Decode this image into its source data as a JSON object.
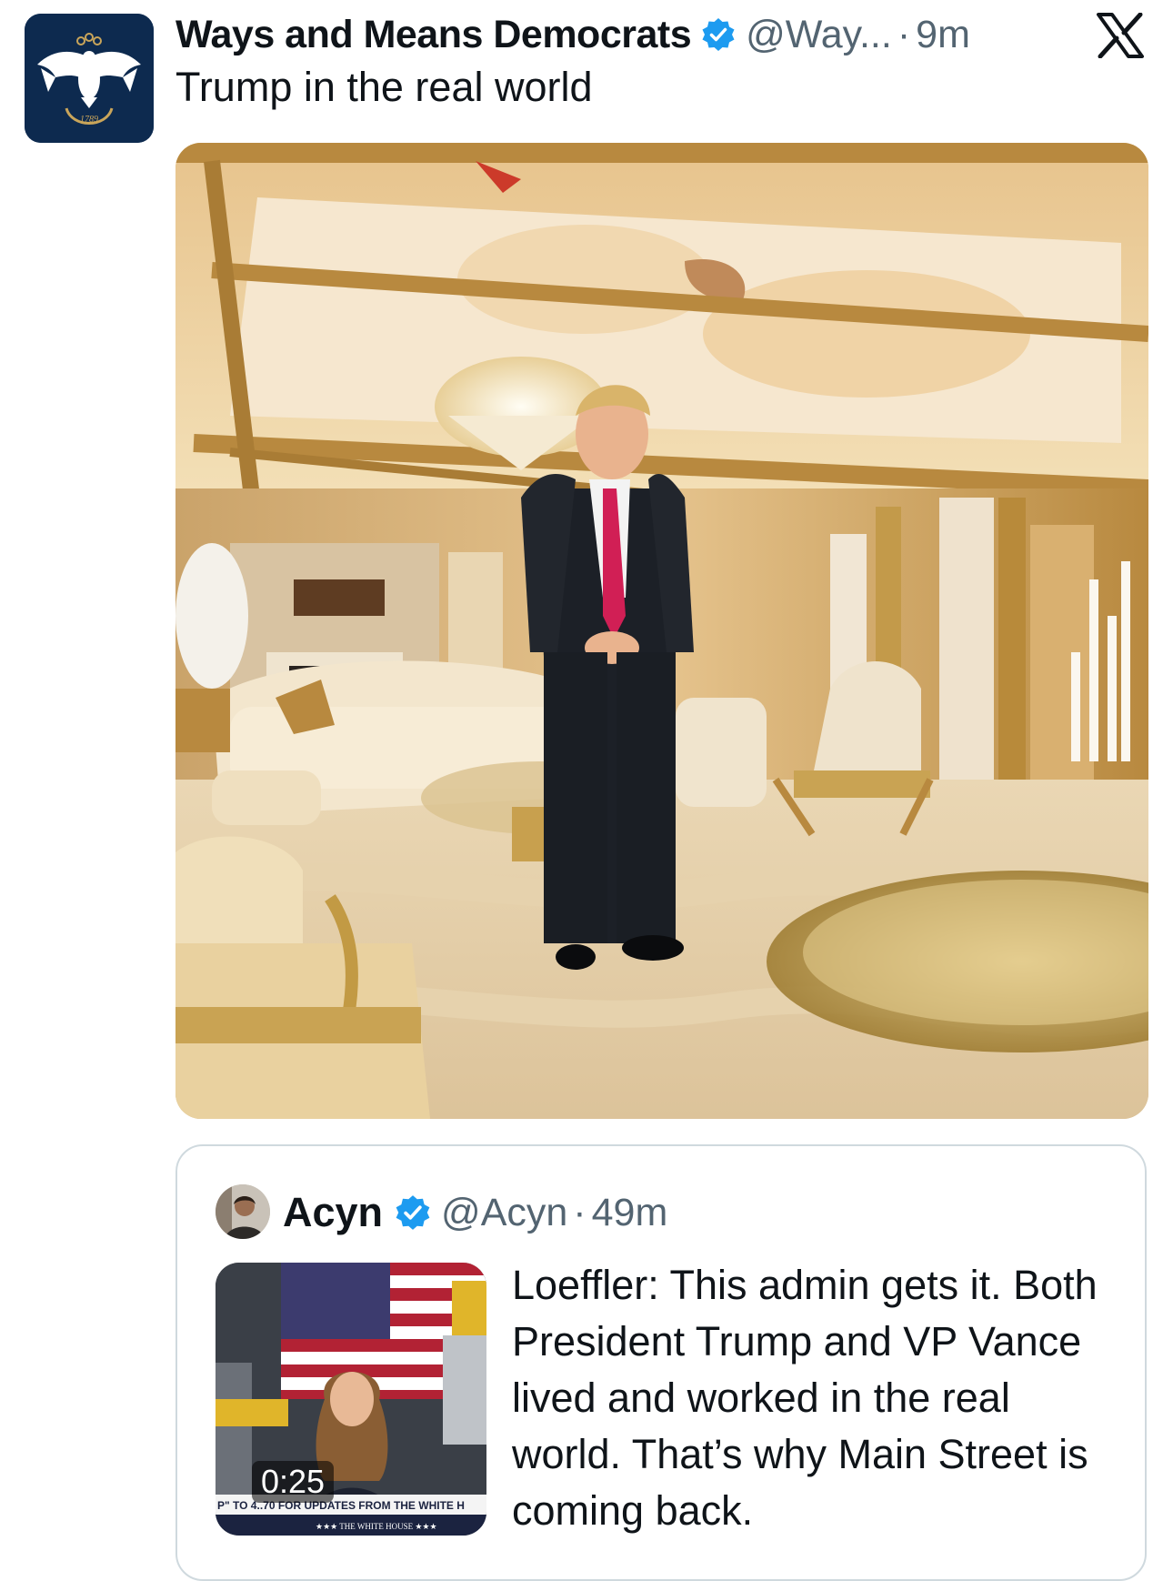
{
  "tweet": {
    "display_name": "Ways and Means Democrats",
    "handle": "@Way...",
    "separator": "·",
    "time": "9m",
    "text": "Trump in the real world",
    "avatar_year": "1789",
    "verified": true,
    "photo_icon": "photo-icon"
  },
  "quoted": {
    "display_name": "Acyn",
    "handle": "@Acyn",
    "separator": "·",
    "time": "49m",
    "text": "Loeffler: This admin gets it. Both President Trump and VP Vance lived and worked in the real world. That’s why Main Street is coming back.",
    "video_duration": "0:25",
    "verified": true,
    "video_ticker": "P\" TO 4..70 FOR UPDATES FROM THE WHITE H",
    "video_sub_ticker": "★★★ THE WHITE HOUSE ★★★"
  },
  "colors": {
    "verified_blue": "#1d9bf0",
    "secondary_text": "#536471",
    "primary_text": "#0f1419",
    "card_border": "#cfd9de",
    "avatar_navy": "#0d2a4f"
  },
  "icons": {
    "brand": "x-logo-icon",
    "verified": "verified-badge-icon"
  }
}
